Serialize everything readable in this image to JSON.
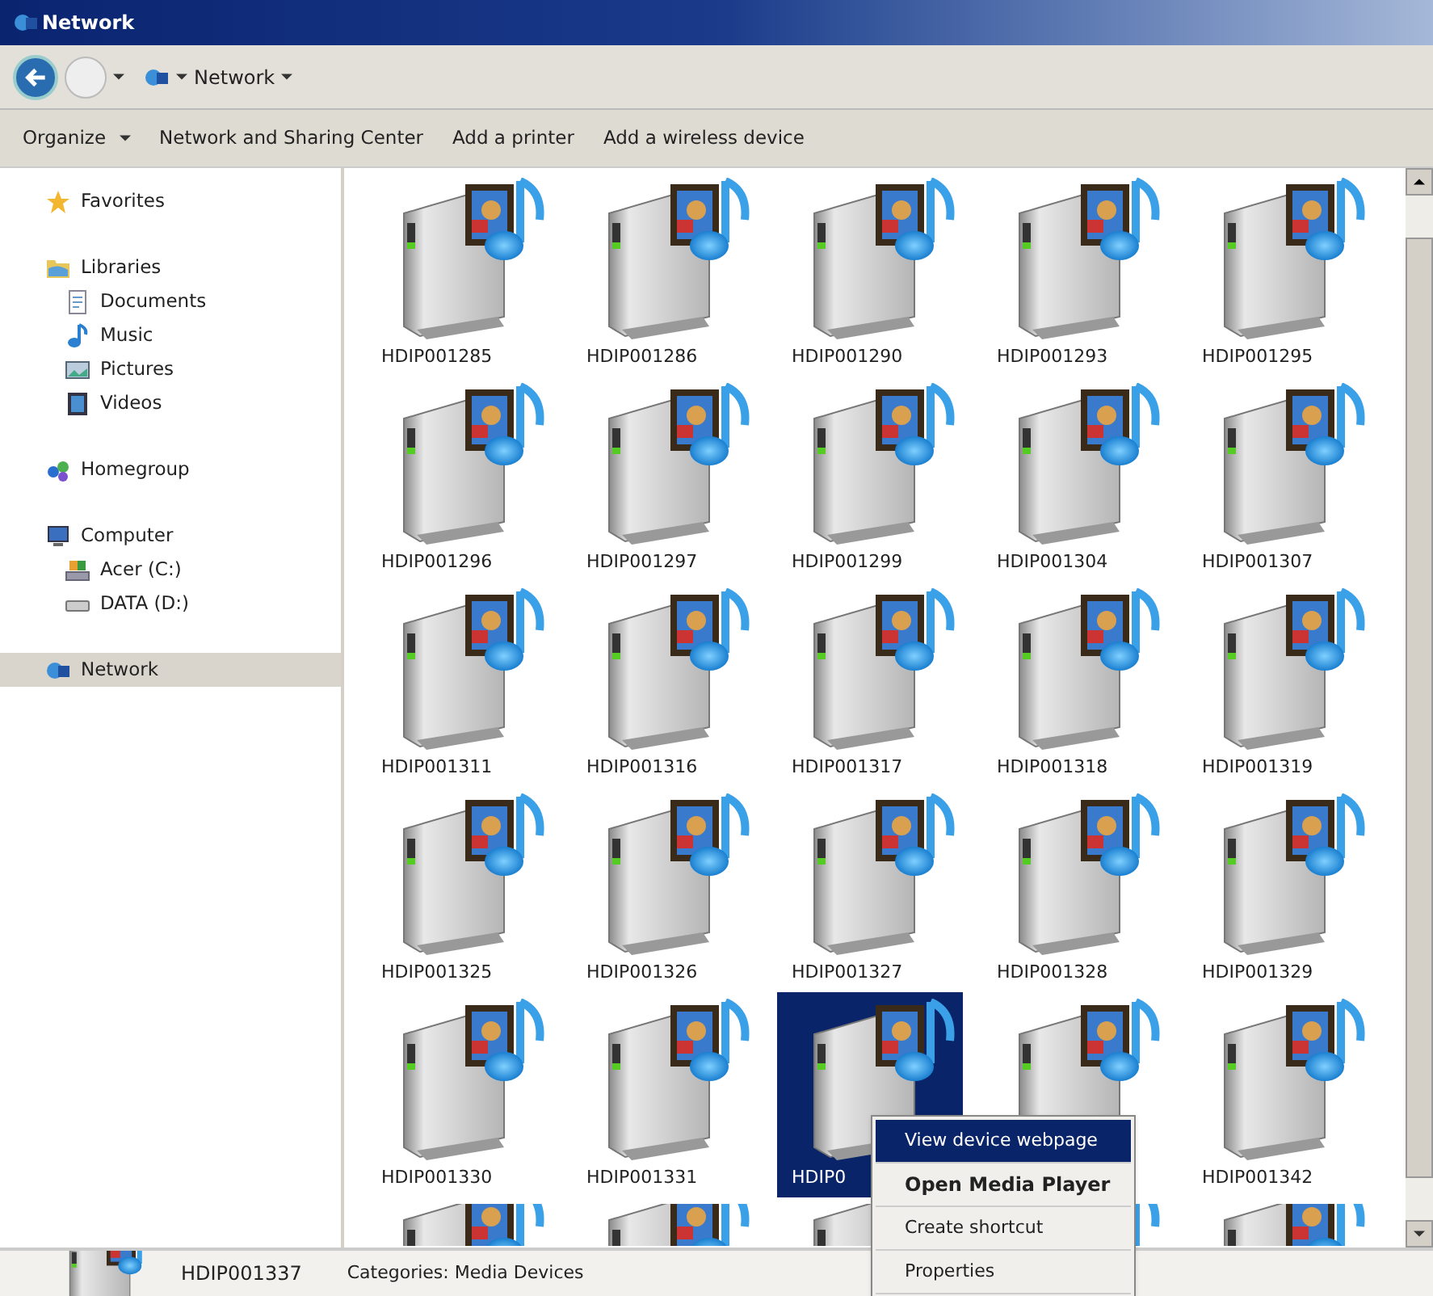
{
  "window": {
    "title": "Network"
  },
  "address_bar": {
    "path": "Network"
  },
  "command_bar": [
    {
      "label": "Organize",
      "menu": true
    },
    {
      "label": "Network and Sharing Center",
      "menu": false
    },
    {
      "label": "Add a printer",
      "menu": false
    },
    {
      "label": "Add a wireless device",
      "menu": false
    }
  ],
  "navigation": [
    {
      "label": "Favorites",
      "kind": "star",
      "selected": false
    },
    {
      "label": "Libraries",
      "kind": "folder",
      "selected": false,
      "children": [
        {
          "label": "Documents",
          "kind": "document",
          "selected": false
        },
        {
          "label": "Music",
          "kind": "music",
          "selected": false
        },
        {
          "label": "Pictures",
          "kind": "picture",
          "selected": false
        },
        {
          "label": "Videos",
          "kind": "video",
          "selected": false
        }
      ]
    },
    {
      "label": "Homegroup",
      "kind": "homegroup",
      "selected": false
    },
    {
      "label": "Computer",
      "kind": "computer",
      "selected": false,
      "children": [
        {
          "label": "Acer (C:)",
          "kind": "system-drive",
          "selected": false
        },
        {
          "label": "DATA (D:)",
          "kind": "drive",
          "selected": false
        }
      ]
    },
    {
      "label": "Network",
      "kind": "network",
      "selected": true
    }
  ],
  "devices": [
    {
      "kind": "full",
      "label": "HDIP001285",
      "selected": false
    },
    {
      "kind": "full",
      "label": "HDIP001286",
      "selected": false
    },
    {
      "kind": "full",
      "label": "HDIP001290",
      "selected": false
    },
    {
      "kind": "full",
      "label": "HDIP001293",
      "selected": false
    },
    {
      "kind": "full",
      "label": "HDIP001295",
      "selected": false
    },
    {
      "kind": "full",
      "label": "HDIP001296",
      "selected": false
    },
    {
      "kind": "full",
      "label": "HDIP001297",
      "selected": false
    },
    {
      "kind": "full",
      "label": "HDIP001299",
      "selected": false
    },
    {
      "kind": "full",
      "label": "HDIP001304",
      "selected": false
    },
    {
      "kind": "full",
      "label": "HDIP001307",
      "selected": false
    },
    {
      "kind": "full",
      "label": "HDIP001311",
      "selected": false
    },
    {
      "kind": "full",
      "label": "HDIP001316",
      "selected": false
    },
    {
      "kind": "full",
      "label": "HDIP001317",
      "selected": false
    },
    {
      "kind": "full",
      "label": "HDIP001318",
      "selected": false
    },
    {
      "kind": "full",
      "label": "HDIP001319",
      "selected": false
    },
    {
      "kind": "full",
      "label": "HDIP001325",
      "selected": false
    },
    {
      "kind": "full",
      "label": "HDIP001326",
      "selected": false
    },
    {
      "kind": "full",
      "label": "HDIP001327",
      "selected": false
    },
    {
      "kind": "full",
      "label": "HDIP001328",
      "selected": false
    },
    {
      "kind": "full",
      "label": "HDIP001329",
      "selected": false
    },
    {
      "kind": "full",
      "label": "HDIP001330",
      "selected": false
    },
    {
      "kind": "full",
      "label": "HDIP001331",
      "selected": false
    },
    {
      "kind": "full",
      "label": "HDIP0",
      "selected": true
    },
    {
      "kind": "full",
      "selected": false
    },
    {
      "kind": "full",
      "label": "HDIP001342",
      "selected": false
    },
    {
      "kind": "cut-off",
      "selected": false
    },
    {
      "kind": "cut-off",
      "selected": false
    },
    {
      "kind": "cut-off",
      "selected": false
    },
    {
      "kind": "cut-off",
      "selected": false
    },
    {
      "kind": "cut-off",
      "selected": false
    }
  ],
  "context_menu": [
    {
      "label": "View device webpage",
      "selected": true,
      "default": false
    },
    {
      "label": "Open Media Player",
      "selected": false,
      "default": true
    },
    {
      "label": "Create shortcut",
      "selected": false,
      "default": false
    },
    {
      "label": "Properties",
      "selected": false,
      "default": false
    }
  ],
  "status_bar": {
    "name": "HDIP001337",
    "categories": "Categories: Media Devices"
  }
}
